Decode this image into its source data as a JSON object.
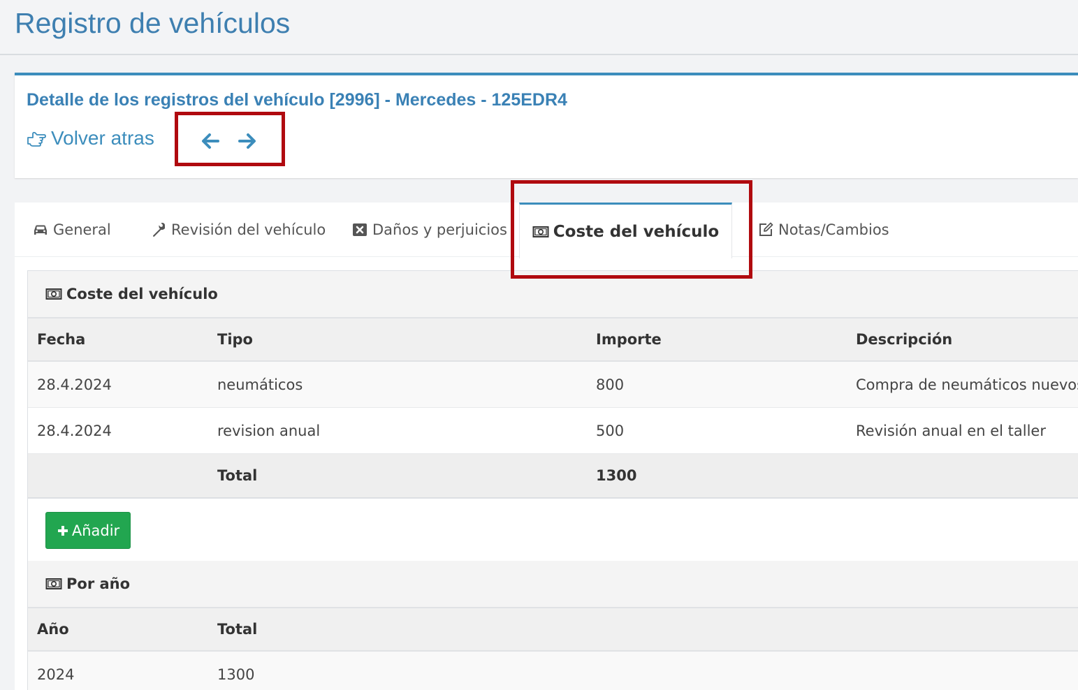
{
  "page": {
    "title": "Registro de vehículos"
  },
  "detail": {
    "title": "Detalle de los registros del vehículo [2996] - Mercedes - 125EDR4",
    "back_label": "Volver atras"
  },
  "tabs": [
    {
      "label": "General",
      "icon": "car-icon"
    },
    {
      "label": "Revisión del vehículo",
      "icon": "wrench-icon"
    },
    {
      "label": "Daños y perjuicios",
      "icon": "close-box-icon"
    },
    {
      "label": "Coste del vehículo",
      "icon": "money-icon",
      "active": true
    },
    {
      "label": "Notas/Cambios",
      "icon": "edit-icon"
    }
  ],
  "costs": {
    "header": "Coste del vehículo",
    "columns": [
      "Fecha",
      "Tipo",
      "Importe",
      "Descripción"
    ],
    "rows": [
      [
        "28.4.2024",
        "neumáticos",
        "800",
        "Compra de neumáticos nuevos"
      ],
      [
        "28.4.2024",
        "revision anual",
        "500",
        "Revisión anual en el taller"
      ]
    ],
    "total_label": "Total",
    "total_value": "1300",
    "add_label": "Añadir"
  },
  "by_year": {
    "header": "Por año",
    "columns": [
      "Año",
      "Total"
    ],
    "rows": [
      [
        "2024",
        "1300"
      ]
    ]
  },
  "colors": {
    "accent": "#3c8dbc",
    "highlight": "#b00a0f",
    "add_button": "#22a650"
  }
}
